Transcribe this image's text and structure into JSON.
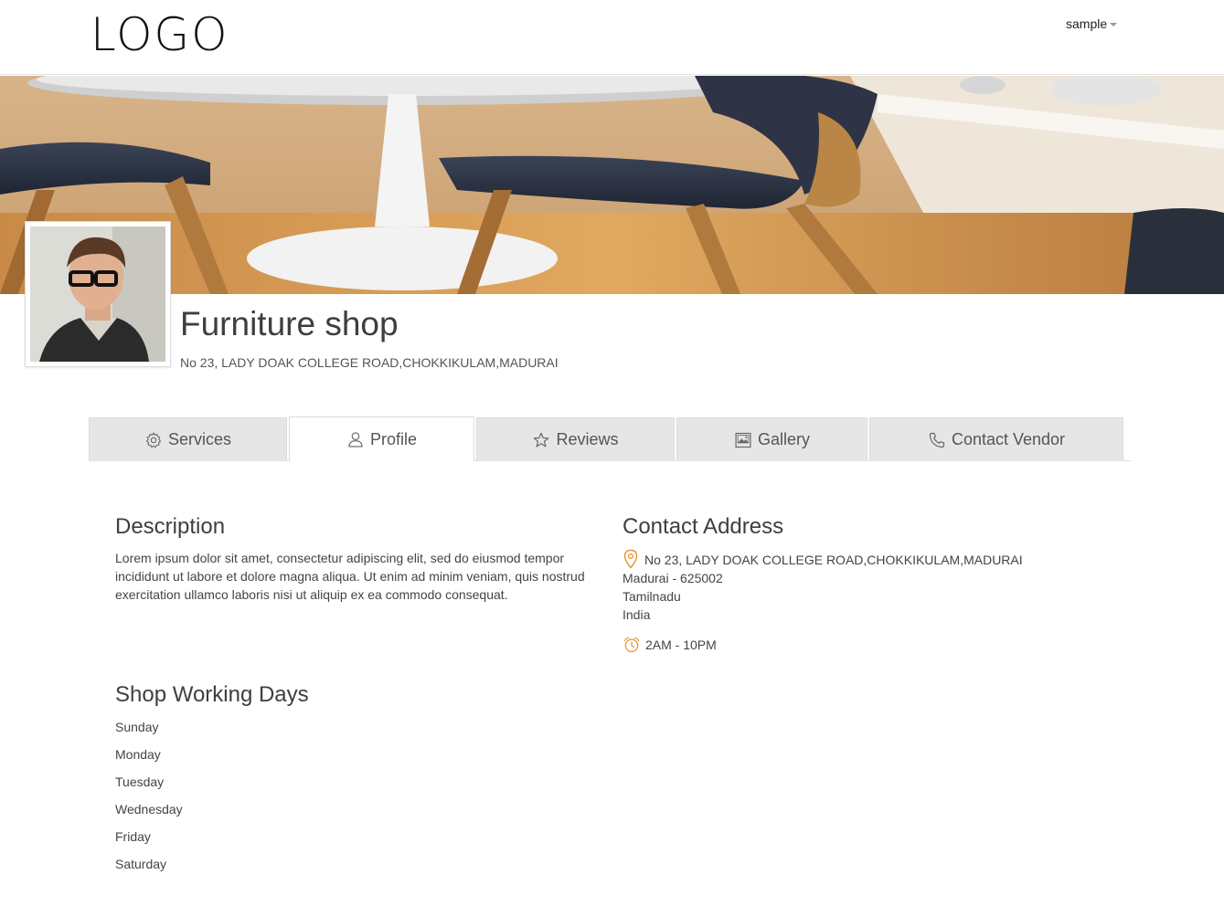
{
  "header": {
    "logo_text": "LOGO",
    "user_label": "sample"
  },
  "shop": {
    "name": "Furniture shop",
    "address": "No 23, LADY DOAK COLLEGE ROAD,CHOKKIKULAM,MADURAI"
  },
  "tabs": [
    {
      "label": "Services",
      "icon": "gear-icon"
    },
    {
      "label": "Profile",
      "icon": "user-icon",
      "active": true
    },
    {
      "label": "Reviews",
      "icon": "star-icon"
    },
    {
      "label": "Gallery",
      "icon": "image-icon"
    },
    {
      "label": "Contact Vendor",
      "icon": "phone-icon"
    }
  ],
  "description": {
    "title": "Description",
    "text": "Lorem ipsum dolor sit amet, consectetur adipiscing elit, sed do eiusmod tempor incididunt ut labore et dolore magna aliqua. Ut enim ad minim veniam, quis nostrud exercitation ullamco laboris nisi ut aliquip ex ea commodo consequat."
  },
  "contact": {
    "title": "Contact Address",
    "line1": "No 23, LADY DOAK COLLEGE ROAD,CHOKKIKULAM,MADURAI",
    "line2": "Madurai - 625002",
    "line3": "Tamilnadu",
    "line4": "India",
    "hours": "2AM - 10PM"
  },
  "working_days": {
    "title": "Shop Working Days",
    "days": [
      "Sunday",
      "Monday",
      "Tuesday",
      "Wednesday",
      "Friday",
      "Saturday"
    ]
  },
  "colors": {
    "accent": "#e8932f",
    "tab_bg": "#e6e6e6"
  }
}
